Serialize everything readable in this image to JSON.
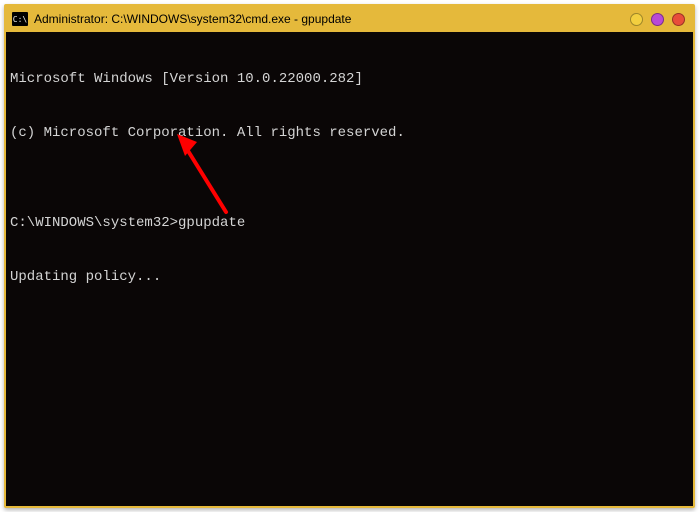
{
  "window": {
    "title": "Administrator: C:\\WINDOWS\\system32\\cmd.exe - gpupdate",
    "icon_label": "C:\\"
  },
  "terminal": {
    "line_version": "Microsoft Windows [Version 10.0.22000.282]",
    "line_copyright": "(c) Microsoft Corporation. All rights reserved.",
    "blank": "",
    "prompt": "C:\\WINDOWS\\system32>",
    "command": "gpupdate",
    "status": "Updating policy..."
  }
}
